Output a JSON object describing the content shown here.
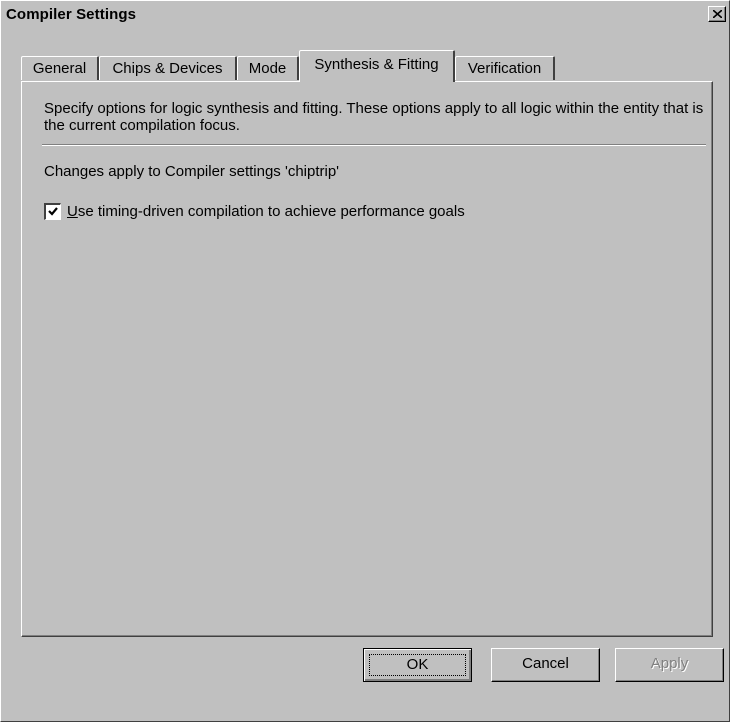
{
  "window": {
    "title": "Compiler Settings"
  },
  "tabs": [
    {
      "label": "General",
      "selected": false
    },
    {
      "label": "Chips & Devices",
      "selected": false
    },
    {
      "label": "Mode",
      "selected": false
    },
    {
      "label": "Synthesis & Fitting",
      "selected": true
    },
    {
      "label": "Verification",
      "selected": false
    }
  ],
  "panel": {
    "description": "Specify options for logic synthesis and fitting.  These options apply to all logic within the entity that is the current compilation focus.",
    "changes_text": "Changes apply to Compiler settings 'chiptrip'",
    "checkbox": {
      "label": "Use timing-driven compilation to achieve performance goals",
      "checked": true
    }
  },
  "buttons": {
    "ok": "OK",
    "cancel": "Cancel",
    "apply": "Apply",
    "apply_enabled": false
  },
  "icons": {
    "close": "close-icon",
    "check": "checkmark-icon"
  }
}
